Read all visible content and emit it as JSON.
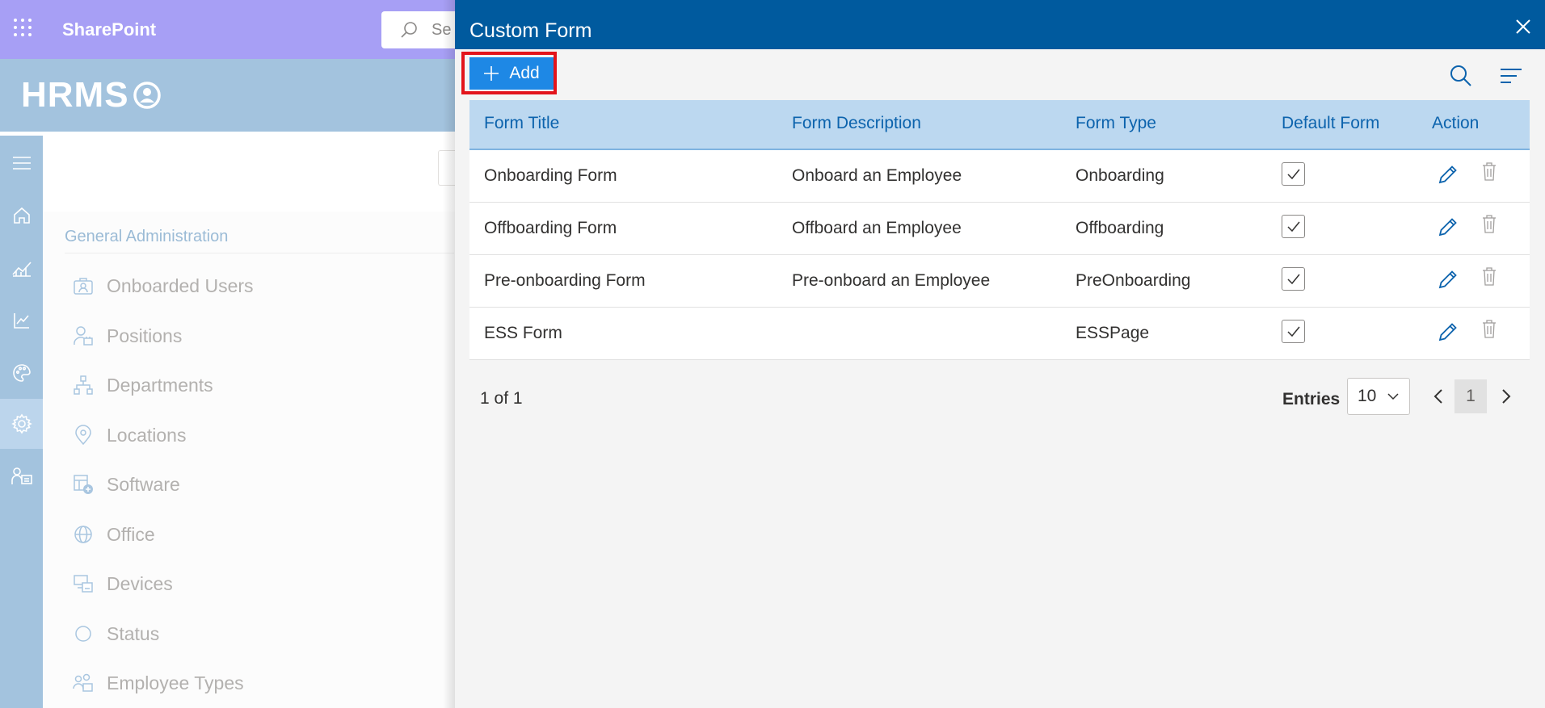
{
  "suite": {
    "title": "SharePoint",
    "search_placeholder": "Se"
  },
  "app": {
    "logo_text": "HRMS"
  },
  "admin": {
    "heading": "General Administration",
    "items": [
      {
        "label": "Onboarded Users",
        "icon": "onboarded-users-icon"
      },
      {
        "label": "Positions",
        "icon": "positions-icon"
      },
      {
        "label": "Departments",
        "icon": "departments-icon"
      },
      {
        "label": "Locations",
        "icon": "location-pin-icon"
      },
      {
        "label": "Software",
        "icon": "software-icon"
      },
      {
        "label": "Office",
        "icon": "globe-icon"
      },
      {
        "label": "Devices",
        "icon": "devices-icon"
      },
      {
        "label": "Status",
        "icon": "status-circle-icon"
      },
      {
        "label": "Employee Types",
        "icon": "employee-types-icon"
      }
    ]
  },
  "panel": {
    "title": "Custom Form",
    "add_label": "Add",
    "columns": [
      "Form Title",
      "Form Description",
      "Form Type",
      "Default Form",
      "Action"
    ],
    "rows": [
      {
        "title": "Onboarding Form",
        "description": "Onboard an Employee",
        "type": "Onboarding",
        "default": true
      },
      {
        "title": "Offboarding Form",
        "description": "Offboard an Employee",
        "type": "Offboarding",
        "default": true
      },
      {
        "title": "Pre-onboarding Form",
        "description": "Pre-onboard an Employee",
        "type": "PreOnboarding",
        "default": true
      },
      {
        "title": "ESS Form",
        "description": "",
        "type": "ESSPage",
        "default": true
      }
    ],
    "footer": {
      "count_text": "1 of 1",
      "entries_label": "Entries",
      "entries_value": "10",
      "current_page": "1"
    }
  },
  "colors": {
    "suite_bar": "#a79ff5",
    "app_band": "#a3c3de",
    "panel_header": "#005a9e",
    "add_button": "#1e88e5",
    "highlight": "#e3141b",
    "table_header": "#bcd8f0"
  }
}
